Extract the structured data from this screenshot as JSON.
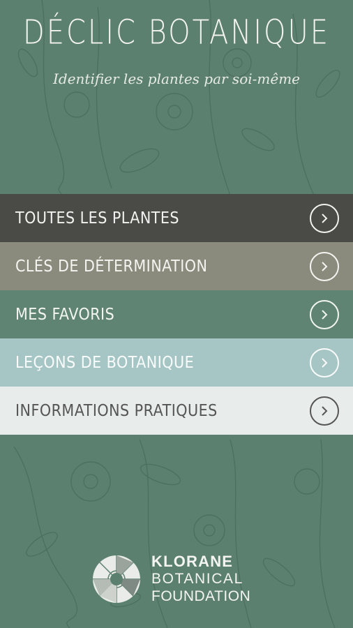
{
  "header": {
    "title": "DÉCLIC BOTANIQUE",
    "subtitle": "Identifier les plantes par soi-même"
  },
  "menu": {
    "items": [
      {
        "label": "TOUTES LES PLANTES",
        "icon": "chevron-right-circle-icon",
        "color": "#4a4a47"
      },
      {
        "label": "CLÉS DE DÉTERMINATION",
        "icon": "chevron-right-circle-icon",
        "color": "#8b8b7d"
      },
      {
        "label": "MES FAVORIS",
        "icon": "chevron-right-circle-icon",
        "color": "#5f8473"
      },
      {
        "label": "LEÇONS DE BOTANIQUE",
        "icon": "chevron-right-circle-icon",
        "color": "#a6c5c5"
      },
      {
        "label": "INFORMATIONS PRATIQUES",
        "icon": "chevron-right-circle-icon",
        "color": "#e8ecea"
      }
    ]
  },
  "footer": {
    "logo_line1": "KLORANE",
    "logo_line2": "BOTANICAL",
    "logo_line3": "FOUNDATION"
  },
  "colors": {
    "background": "#5c8070",
    "pattern": "#4f7262"
  }
}
